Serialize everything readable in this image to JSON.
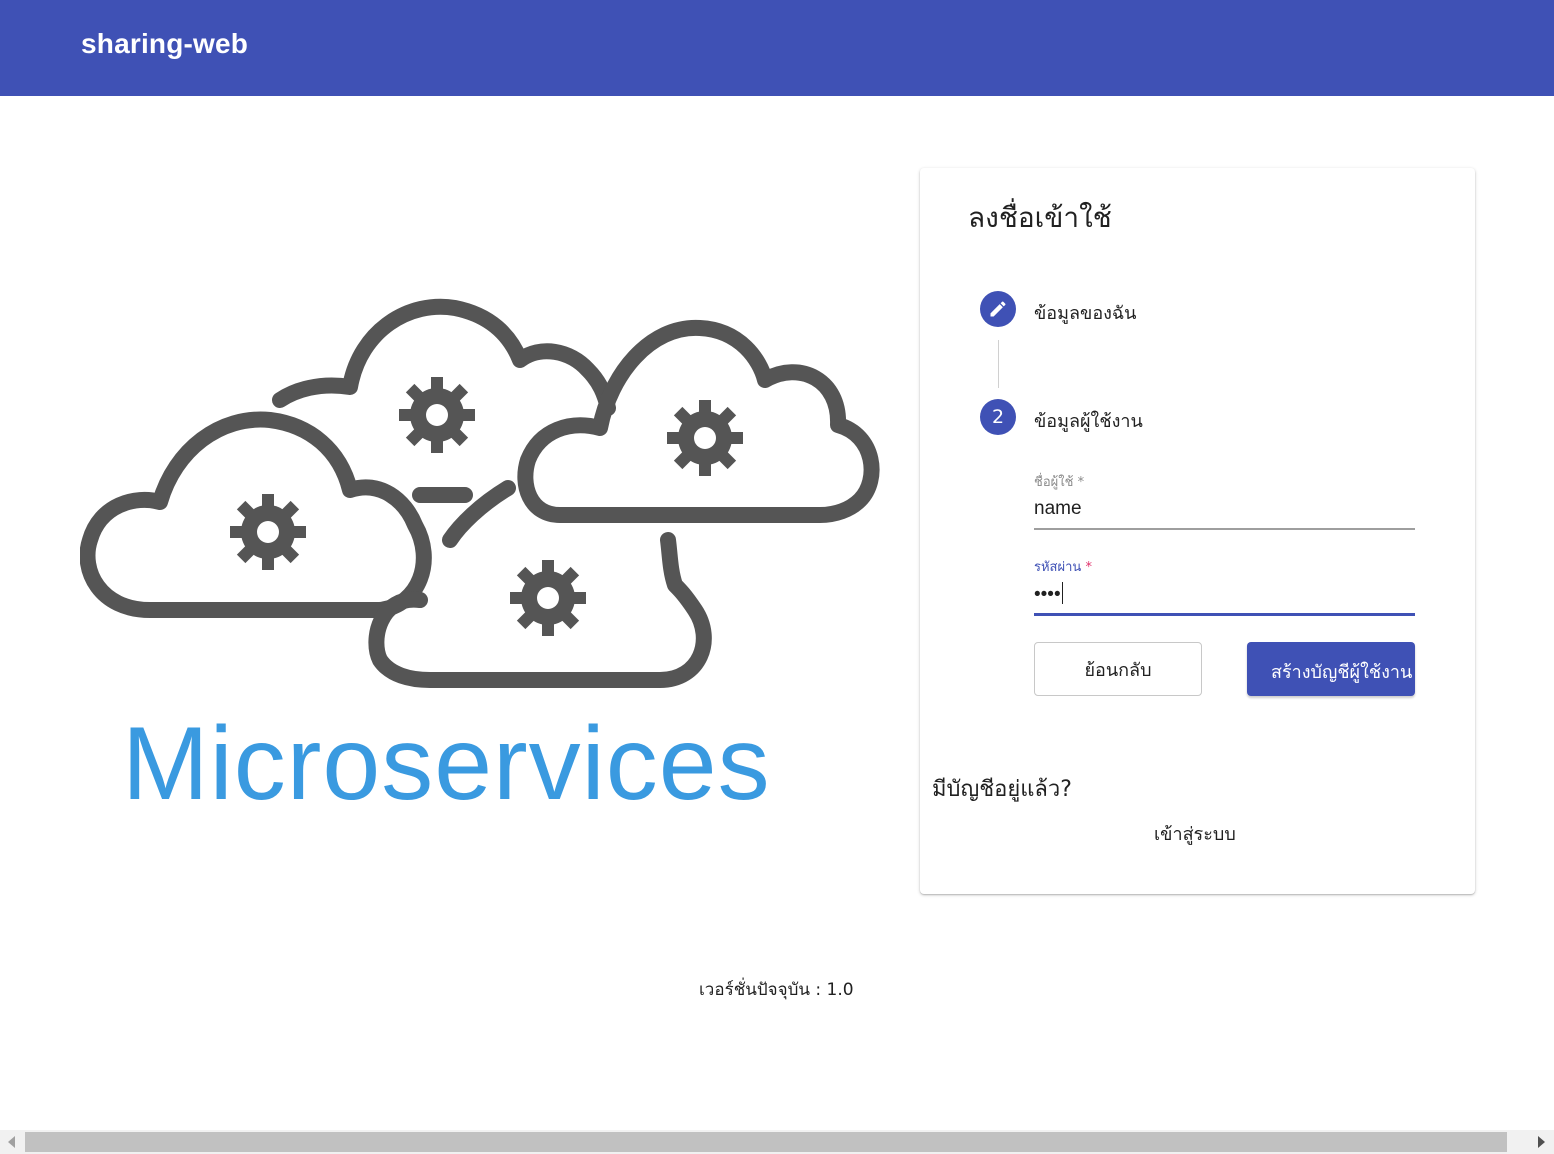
{
  "appbar": {
    "title": "sharing-web",
    "color": "#3f51b5"
  },
  "hero": {
    "title": "Microservices",
    "illustration": "clouds-with-gears",
    "text_color": "#3a9ae0"
  },
  "signup": {
    "title": "ลงชื่อเข้าใช้",
    "steps": [
      {
        "label": "ข้อมูลของฉัน",
        "icon": "pencil-icon",
        "state": "edit"
      },
      {
        "label": "ข้อมูลผู้ใช้งาน",
        "number": "2",
        "state": "active"
      }
    ],
    "username": {
      "label": "ชื่อผู้ใช้",
      "required_mark": "*",
      "value": "name"
    },
    "password": {
      "label": "รหัสผ่าน",
      "required_mark": "*",
      "value": "••••"
    },
    "back_label": "ย้อนกลับ",
    "create_label": "สร้างบัญชีผู้ใช้งาน",
    "have_account": "มีบัญชีอยู่แล้ว?",
    "login_label": "เข้าสู่ระบบ"
  },
  "footer": {
    "version": "เวอร์ชั่นปัจจุบัน : 1.0"
  }
}
